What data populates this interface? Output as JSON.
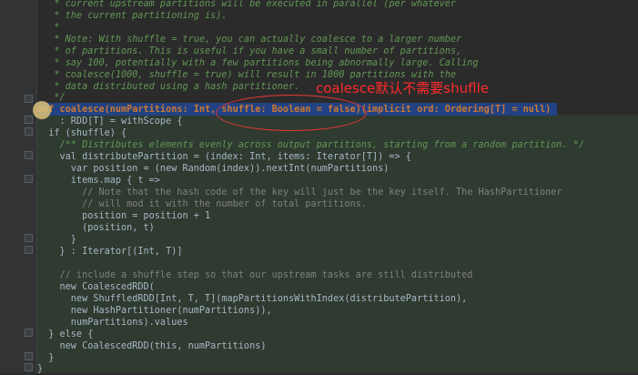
{
  "annotation": {
    "text": "coalesce默认不需要shuflle"
  },
  "code": [
    {
      "text": "   * current upstream partitions will be executed in parallel (per whatever",
      "kind": "comment"
    },
    {
      "text": "   * the current partitioning is).",
      "kind": "comment"
    },
    {
      "text": "   *",
      "kind": "comment"
    },
    {
      "text": "   * Note: With shuffle = true, you can actually coalesce to a larger number",
      "kind": "comment"
    },
    {
      "text": "   * of partitions. This is useful if you have a small number of partitions,",
      "kind": "comment"
    },
    {
      "text": "   * say 100, potentially with a few partitions being abnormally large. Calling",
      "kind": "comment"
    },
    {
      "text": "   * coalesce(1000, shuffle = true) will result in 1000 partitions with the",
      "kind": "comment"
    },
    {
      "text": "   * data distributed using a hash partitioner.",
      "kind": "comment"
    },
    {
      "text": "   */",
      "kind": "comment"
    },
    {
      "text": "def coalesce(numPartitions: Int, shuffle: Boolean = false)(implicit ord: Ordering[T] = null)",
      "kind": "signature"
    },
    {
      "text": "    : RDD[T] = withScope {",
      "kind": "plain"
    },
    {
      "text": "  if (shuffle) {",
      "kind": "plain"
    },
    {
      "text": "    /** Distributes elements evenly across output partitions, starting from a random partition. */",
      "kind": "comment"
    },
    {
      "text": "    val distributePartition = (index: Int, items: Iterator[T]) => {",
      "kind": "plain"
    },
    {
      "text": "      var position = (new Random(index)).nextInt(numPartitions)",
      "kind": "plain"
    },
    {
      "text": "      items.map { t =>",
      "kind": "plain"
    },
    {
      "text": "        // Note that the hash code of the key will just be the key itself. The HashPartitioner",
      "kind": "linecomment"
    },
    {
      "text": "        // will mod it with the number of total partitions.",
      "kind": "linecomment"
    },
    {
      "text": "        position = position + 1",
      "kind": "plain"
    },
    {
      "text": "        (position, t)",
      "kind": "plain"
    },
    {
      "text": "      }",
      "kind": "plain"
    },
    {
      "text": "    } : Iterator[(Int, T)]",
      "kind": "plain"
    },
    {
      "text": "",
      "kind": "plain"
    },
    {
      "text": "    // include a shuffle step so that our upstream tasks are still distributed",
      "kind": "linecomment"
    },
    {
      "text": "    new CoalescedRDD(",
      "kind": "plain"
    },
    {
      "text": "      new ShuffledRDD[Int, T, T](mapPartitionsWithIndex(distributePartition),",
      "kind": "plain"
    },
    {
      "text": "      new HashPartitioner(numPartitions)),",
      "kind": "plain"
    },
    {
      "text": "      numPartitions).values",
      "kind": "plain"
    },
    {
      "text": "  } else {",
      "kind": "plain"
    },
    {
      "text": "    new CoalescedRDD(this, numPartitions)",
      "kind": "plain"
    },
    {
      "text": "  }",
      "kind": "plain"
    },
    {
      "text": "}",
      "kind": "plain"
    }
  ]
}
